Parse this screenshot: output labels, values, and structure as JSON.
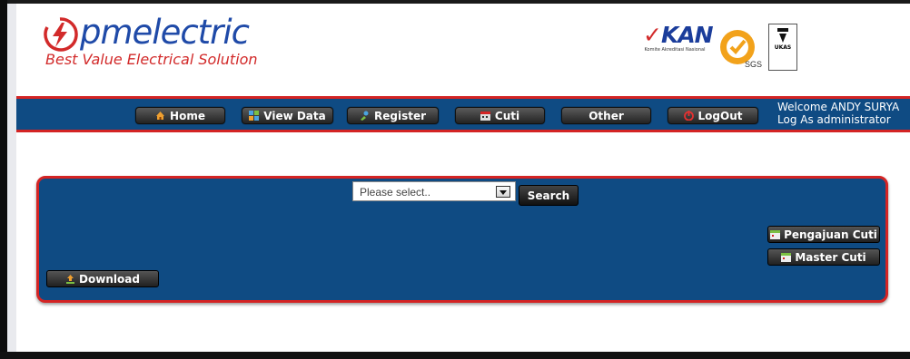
{
  "header": {
    "brand_name": "pmelectric",
    "tagline": "Best Value Electrical Solution",
    "kan_label": "KAN",
    "kan_sub": "Komite Akreditasi Nasional",
    "sgs_label": "SGS",
    "ukas_label": "UKAS"
  },
  "nav": {
    "items": [
      {
        "label": "Home",
        "icon": "house-icon"
      },
      {
        "label": "View Data",
        "icon": "grid-icon"
      },
      {
        "label": "Register",
        "icon": "register-icon"
      },
      {
        "label": "Cuti",
        "icon": "calendar-icon"
      },
      {
        "label": "Other",
        "icon": ""
      },
      {
        "label": "LogOut",
        "icon": "power-icon"
      }
    ],
    "welcome_line1": "Welcome ANDY SURYA",
    "welcome_line2": "Log As administrator"
  },
  "panel": {
    "select_placeholder": "Please select..",
    "search_label": "Search",
    "pengajuan_label": "Pengajuan Cuti",
    "master_label": "Master Cuti",
    "download_label": "Download"
  },
  "colors": {
    "nav_bg": "#0f4b83",
    "accent_red": "#d42424",
    "brand_blue": "#1f4aa8"
  }
}
